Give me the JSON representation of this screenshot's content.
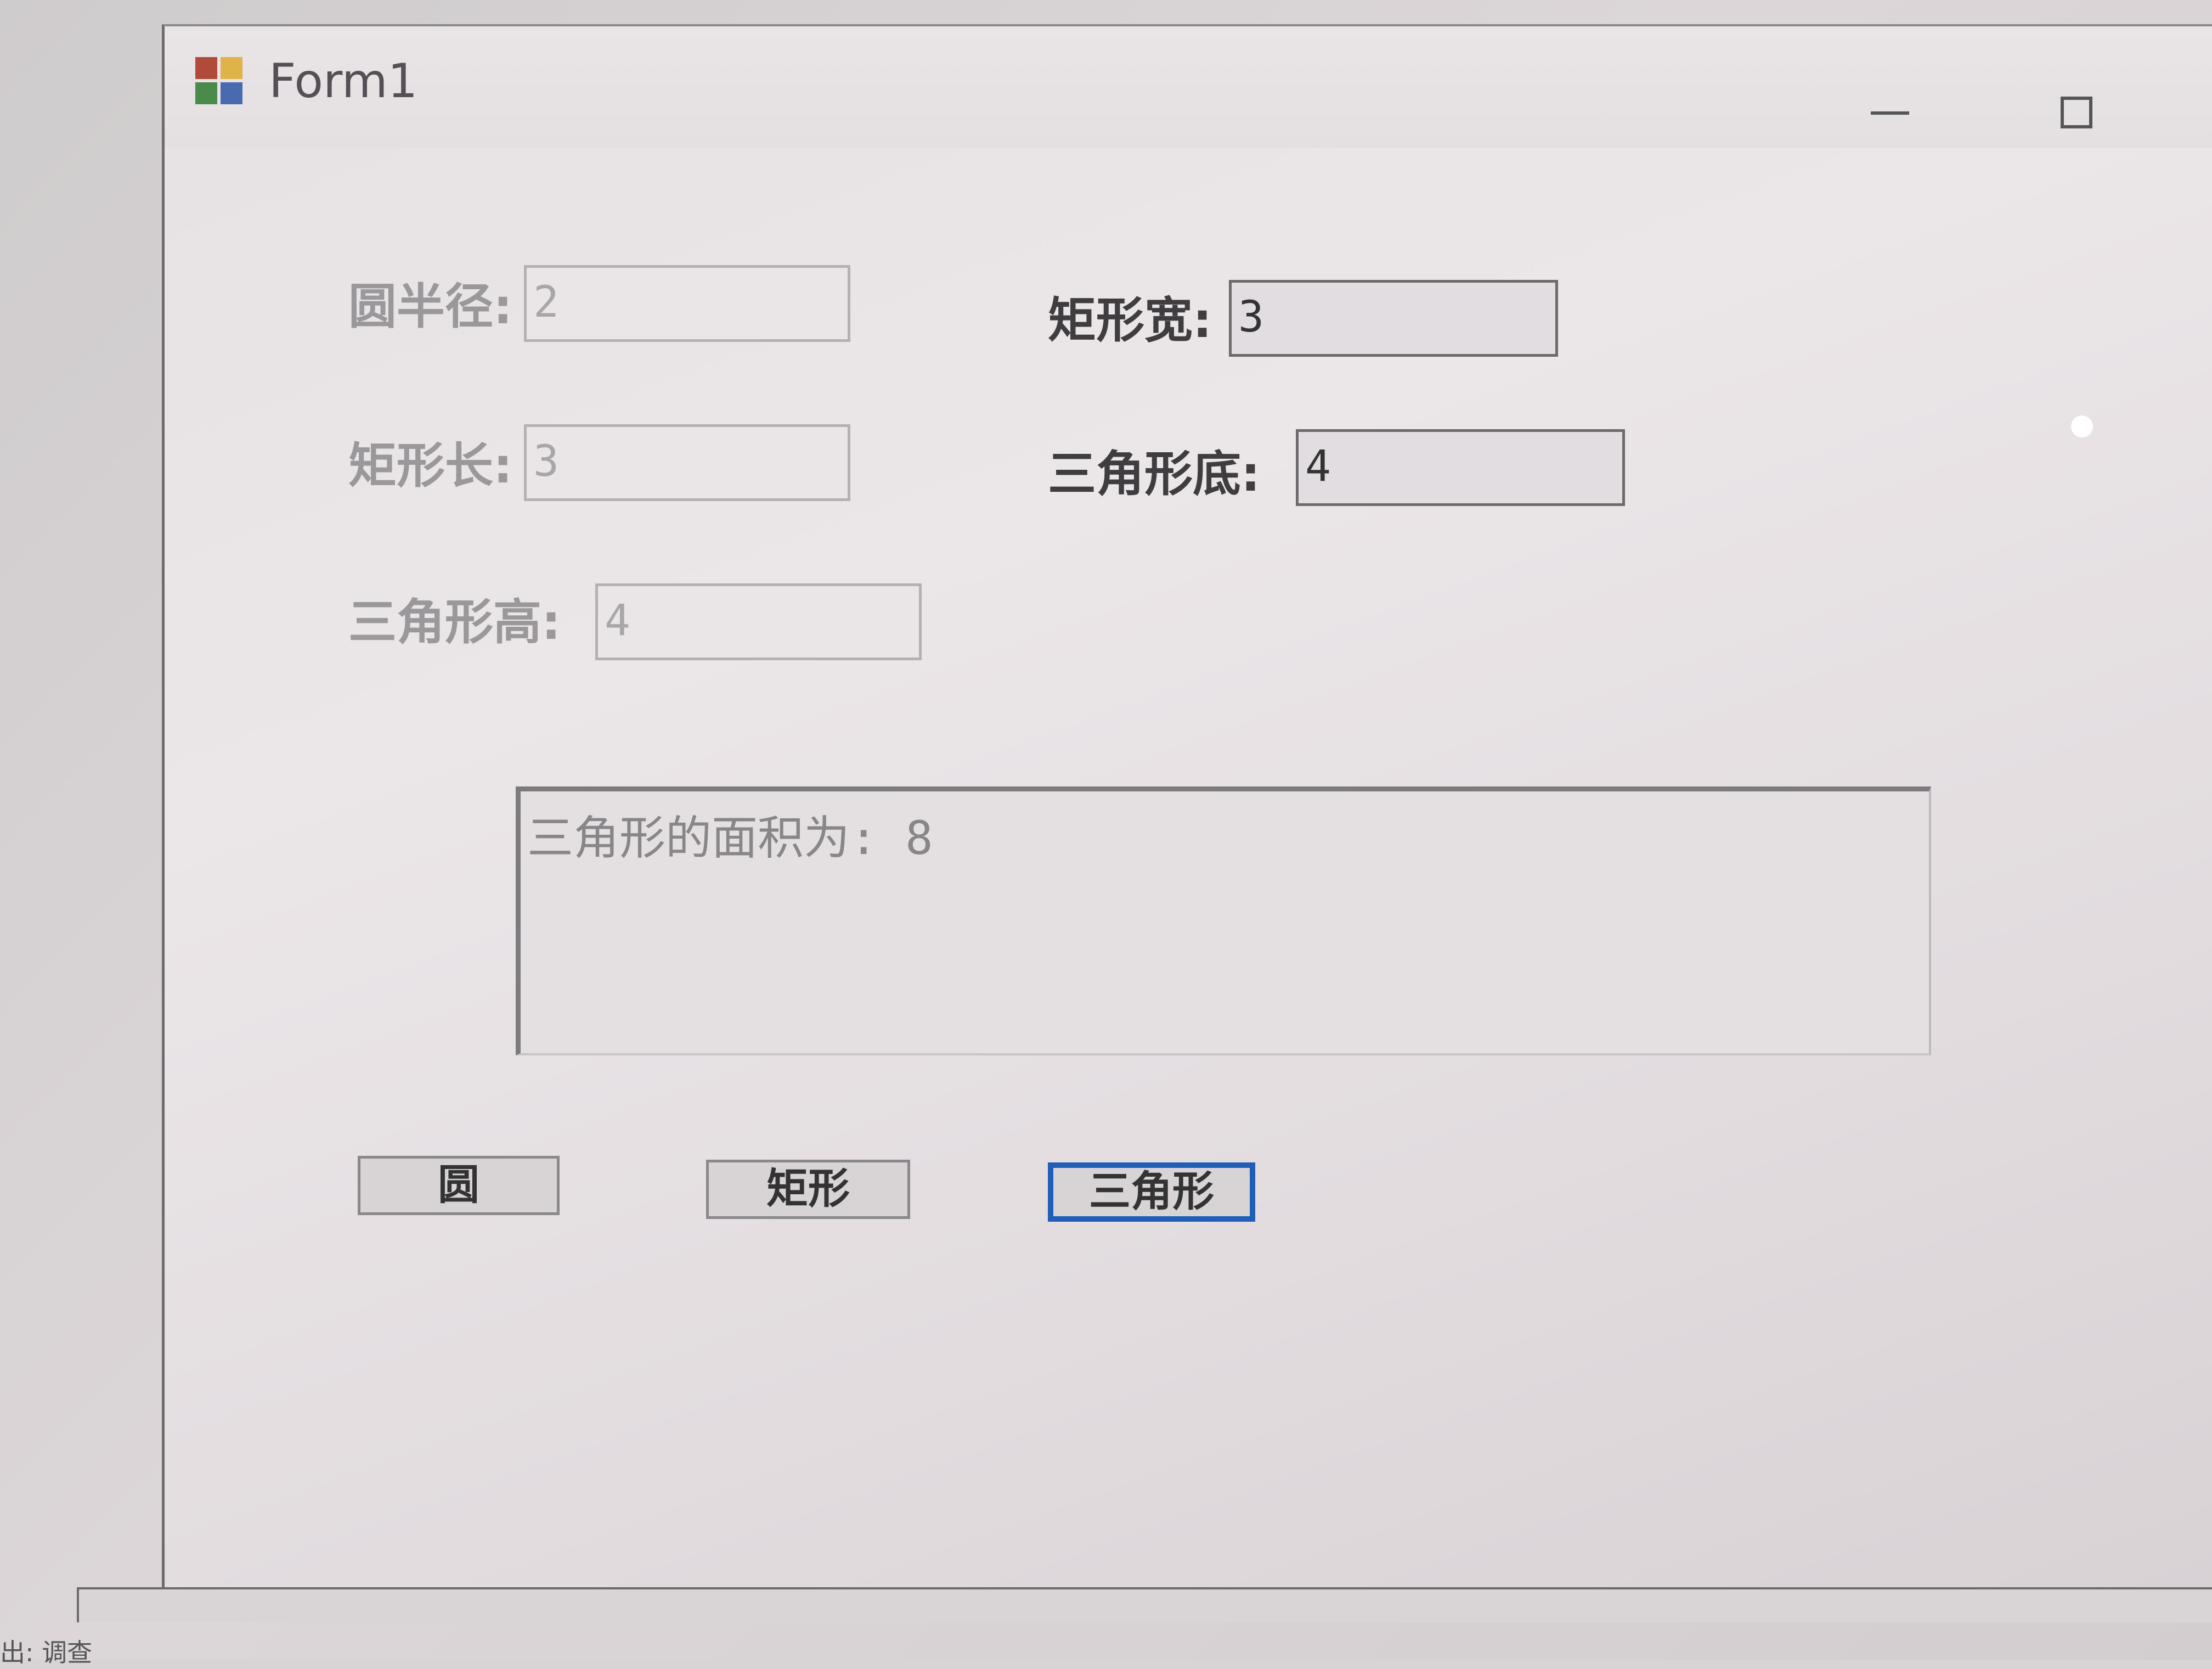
{
  "window": {
    "title": "Form1",
    "icon": "app-form-icon"
  },
  "fields": {
    "circle_radius": {
      "label": "圆半径:",
      "value": "2"
    },
    "rect_width": {
      "label": "矩形宽:",
      "value": "3"
    },
    "rect_length": {
      "label": "矩形长:",
      "value": "3"
    },
    "triangle_base": {
      "label": "三角形底:",
      "value": "4"
    },
    "triangle_height": {
      "label": "三角形高:",
      "value": "4"
    }
  },
  "output": {
    "text": "三角形的面积为: 8"
  },
  "buttons": {
    "circle": "圆",
    "rectangle": "矩形",
    "triangle": "三角形"
  },
  "status": {
    "text": "出: 调查"
  },
  "colors": {
    "focus_border": "#1f5fb8",
    "window_bg": "#e6e2e4"
  }
}
